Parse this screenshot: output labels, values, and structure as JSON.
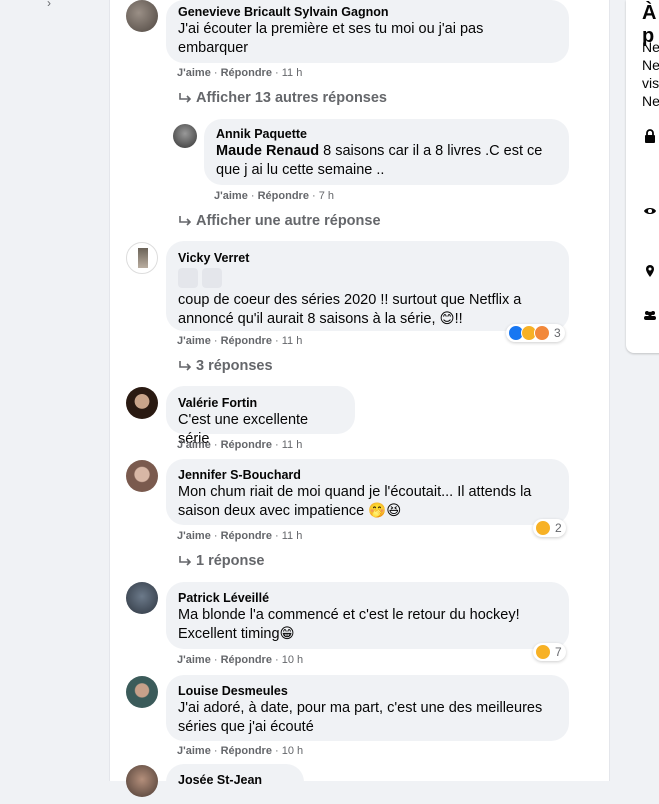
{
  "sidebar": {
    "header": "À p",
    "lines": [
      "Ne",
      "Ne",
      "vis",
      "Ne"
    ]
  },
  "comments": [
    {
      "author": "Genevieve Bricault Sylvain Gagnon",
      "text": "J'ai écouter la première et ses tu moi ou j'ai pas embarquer",
      "like": "J'aime",
      "reply": "Répondre",
      "time": "11 h",
      "more_replies": "Afficher 13 autres réponses"
    },
    {
      "author": "Annik Paquette",
      "mention": "Maude Renaud",
      "text": " 8 saisons car il a 8 livres .C est ce que j ai lu cette semaine ..",
      "like": "J'aime",
      "reply": "Répondre",
      "time": "7 h",
      "more_replies": "Afficher une autre réponse"
    },
    {
      "author": "Vicky Verret",
      "text": "coup de coeur des séries 2020 !! surtout que Netflix a annoncé qu'il aurait 8 saisons à la série, 😊!!",
      "like": "J'aime",
      "reply": "Répondre",
      "time": "11 h",
      "reactions_count": "3",
      "more_replies": "3 réponses"
    },
    {
      "author": "Valérie Fortin",
      "text": "C'est une excellente série",
      "like": "J'aime",
      "reply": "Répondre",
      "time": "11 h"
    },
    {
      "author": "Jennifer S-Bouchard",
      "text": "Mon chum riait de moi quand je l'écoutait... Il attends la saison deux avec impatience 🤭😆",
      "like": "J'aime",
      "reply": "Répondre",
      "time": "11 h",
      "reactions_count": "2",
      "more_replies": "1 réponse"
    },
    {
      "author": "Patrick Léveillé",
      "text": "Ma blonde l'a commencé et c'est le retour du hockey! Excellent timing😁",
      "like": "J'aime",
      "reply": "Répondre",
      "time": "10 h",
      "reactions_count": "7"
    },
    {
      "author": "Louise Desmeules",
      "text": "J'ai adoré, à date, pour ma part, c'est une des meilleures séries que j'ai écouté",
      "like": "J'aime",
      "reply": "Répondre",
      "time": "10 h"
    },
    {
      "author": "Josée St-Jean"
    }
  ],
  "colors": {
    "bubble": "#f0f2f5",
    "meta": "#65676b",
    "like_blue": "#1877f2",
    "haha_yellow": "#f7b125"
  }
}
